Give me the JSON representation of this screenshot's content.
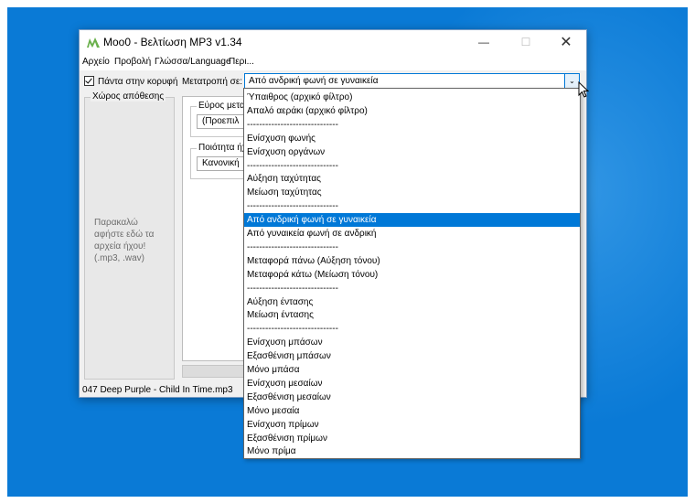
{
  "window": {
    "title": "Moo0 - Βελτίωση MP3 v1.34",
    "minimize": "—",
    "maximize": "☐",
    "close": "✕"
  },
  "menu": [
    "Αρχείο",
    "Προβολή",
    "Γλώσσα/Language",
    "Περι..."
  ],
  "always_on_top": {
    "label": "Πάντα στην κορυφή",
    "checked": true
  },
  "conversion": {
    "label": "Μετατροπή σε:",
    "value": "Από ανδρική φωνή σε γυναικεία"
  },
  "storage": {
    "title": "Χώρος απόθεσης",
    "drop_text": [
      "Παρακαλώ",
      "αφήστε εδώ τα",
      "αρχεία ήχου!",
      "(.mp3, .wav)"
    ]
  },
  "width_group": {
    "label": "Εύρος μεταφ",
    "value": "(Προεπιλ"
  },
  "quality_group": {
    "label": "Ποιότητα ήχ",
    "value": "Κανονική"
  },
  "status": "047  Deep Purple - Child In Time.mp3",
  "dropdown": {
    "selected_index": 9,
    "items": [
      "Ύπαιθρος  (αρχικό φίλτρο)",
      "Απαλό αεράκι  (αρχικό φίλτρο)",
      "------------------------------",
      "Ενίσχυση φωνής",
      "Ενίσχυση οργάνων",
      "------------------------------",
      "Αύξηση ταχύτητας",
      "Μείωση ταχύτητας",
      "------------------------------",
      "Από ανδρική φωνή σε γυναικεία",
      "Από γυναικεία φωνή σε ανδρική",
      "------------------------------",
      "Μεταφορά πάνω  (Αύξηση τόνου)",
      "Μεταφορά κάτω  (Μείωση τόνου)",
      "------------------------------",
      "Αύξηση έντασης",
      "Μείωση έντασης",
      "------------------------------",
      "Ενίσχυση μπάσων",
      "Εξασθένιση μπάσων",
      "Μόνο μπάσα",
      "Ενίσχυση μεσαίων",
      "Εξασθένιση μεσαίων",
      "Μόνο μεσαία",
      "Ενίσχυση πρίμων",
      "Εξασθένιση πρίμων",
      "Μόνο πρίμα"
    ]
  },
  "colors": {
    "desktop": "#0a7ad6",
    "selection": "#0078d7",
    "app_icon": "#6ab04c"
  }
}
